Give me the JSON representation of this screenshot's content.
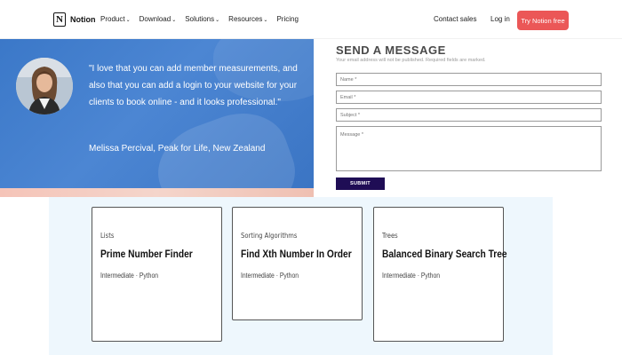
{
  "nav": {
    "brand": "Notion",
    "links": [
      "Product",
      "Download",
      "Solutions",
      "Resources"
    ],
    "pricing": "Pricing",
    "contact": "Contact sales",
    "login": "Log in",
    "cta": "Try Notion free",
    "cta_color": "#eb5757"
  },
  "testimonial": {
    "quote": "\"I love that you can add member measurements, and also that you can add a login to your website for your clients to book online - and it looks professional.\"",
    "author": "Melissa Percival, Peak for Life, New Zealand",
    "bg_color": "#3b78c8"
  },
  "form": {
    "title": "SEND A MESSAGE",
    "note": "Your email address will not be published. Required fields are marked.",
    "name_placeholder": "Name *",
    "email_placeholder": "Email *",
    "subject_placeholder": "Subject *",
    "message_placeholder": "Message *",
    "submit": "SUBMIT",
    "submit_color": "#1f0d55"
  },
  "cards": [
    {
      "category": "Lists",
      "title": "Prime Number Finder",
      "meta": "Intermediate · Python"
    },
    {
      "category": "Sorting Algorithms",
      "title": "Find Xth Number In Order",
      "meta": "Intermediate · Python"
    },
    {
      "category": "Trees",
      "title": "Balanced Binary Search Tree",
      "meta": "Intermediate · Python"
    }
  ]
}
